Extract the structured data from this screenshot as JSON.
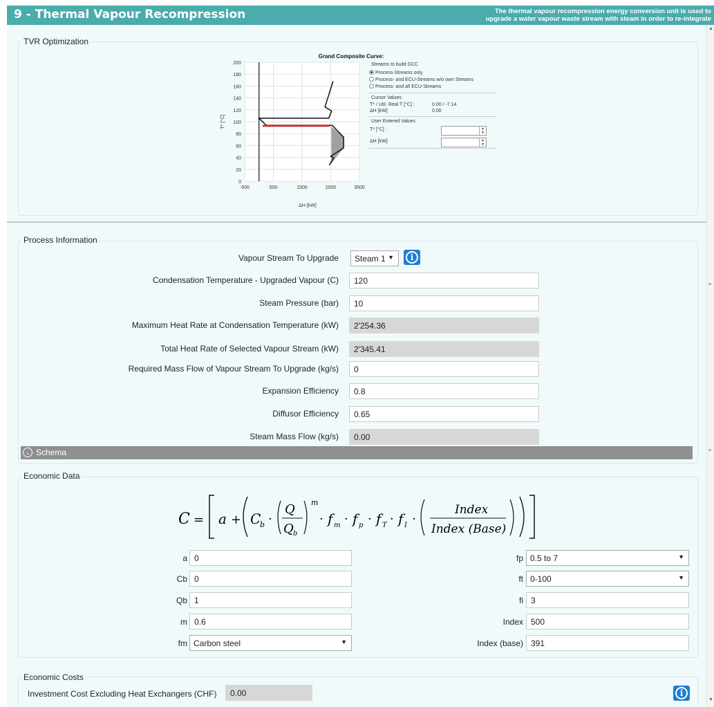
{
  "header": {
    "title": "9 - Thermal Vapour Recompression",
    "description_line1": "The thermal vapour recompression energy conversion unit is used to",
    "description_line2": "upgrade a water vapour waste stream with steam in order to re-integrate"
  },
  "colors": {
    "header_bg": "#4aacac",
    "panel_bg": "#f1fafb",
    "readonly_bg": "#d7d7d7",
    "info_button": "#1e7ed6",
    "curve_red": "#e0262b",
    "fill_grey": "#a0a0a0"
  },
  "tvr": {
    "legend": "TVR Optimization",
    "side": {
      "streams_title": "Streams to build GCC",
      "radio_options": [
        "Process-Streams only",
        "Process- and ECU-Streams w/o own Streams",
        "Process- and all ECU-Streams"
      ],
      "selected_radio": 0,
      "cursor_title": "Cursor Values",
      "cursor_t_label": "T* / Util. Real T [°C] :",
      "cursor_t_value": "0.00 / -7.14",
      "cursor_h_label": "ΔH [kW]",
      "cursor_h_value": "0.00",
      "user_title": "User Entered Values",
      "user_t_label": "T* [°C] :",
      "user_h_label": "ΔH [kW]",
      "spin_icons": [
        "spin-up-icon",
        "spin-down-icon"
      ]
    }
  },
  "chart_data": {
    "type": "line",
    "title": "Grand Composite Curve:",
    "xlabel": "ΔH [kW]",
    "ylabel": "T* [°C]",
    "xlim": [
      -500,
      3500
    ],
    "ylim": [
      0,
      200
    ],
    "x_ticks": [
      "-500",
      "500",
      "1500",
      "2500",
      "3500"
    ],
    "y_ticks": [
      "0",
      "20",
      "40",
      "60",
      "80",
      "100",
      "120",
      "140",
      "160",
      "180",
      "200"
    ],
    "grid": true,
    "series": [
      {
        "style": "black",
        "x": [
          2580,
          2300,
          2530,
          2430,
          0,
          250,
          2550,
          2950,
          2950,
          2500,
          2600,
          2450
        ],
        "y": [
          168,
          125,
          118,
          106,
          106,
          94,
          94,
          74,
          56,
          42,
          39,
          27
        ]
      },
      {
        "style": "red",
        "x": [
          120,
          2470
        ],
        "y": [
          93,
          93
        ]
      },
      {
        "style": "axis",
        "x": [
          0,
          0
        ],
        "y": [
          0,
          200
        ]
      },
      {
        "style": "fill",
        "x": [
          2520,
          2950,
          2950,
          2520
        ],
        "y": [
          92,
          74,
          56,
          30
        ]
      }
    ]
  },
  "process": {
    "legend": "Process Information",
    "fields": [
      {
        "label": "Vapour Stream To Upgrade",
        "value": "Steam 1",
        "kind": "select"
      },
      {
        "label": "Condensation Temperature - Upgraded Vapour (C)",
        "value": "120",
        "kind": "input"
      },
      {
        "label": "Steam Pressure (bar)",
        "value": "10",
        "kind": "input"
      },
      {
        "label": "Maximum Heat Rate at Condensation Temperature (kW)",
        "value": "2'254.36",
        "kind": "readonly"
      },
      {
        "label": "Total Heat Rate of Selected Vapour Stream (kW)",
        "value": "2'345.41",
        "kind": "readonly"
      },
      {
        "label": "Required Mass Flow of Vapour Stream To Upgrade (kg/s)",
        "value": "0",
        "kind": "input"
      },
      {
        "label": "Expansion Efficiency",
        "value": "0.8",
        "kind": "input"
      },
      {
        "label": "Diffusor Efficiency",
        "value": "0.65",
        "kind": "input"
      },
      {
        "label": "Steam Mass Flow (kg/s)",
        "value": "0.00",
        "kind": "readonly"
      }
    ]
  },
  "schema": {
    "label": "Schema"
  },
  "economic": {
    "legend": "Economic Data",
    "formula": {
      "C": "C",
      "eq": "=",
      "a": "a",
      "plus": "+",
      "Cb": "C",
      "b": "b",
      "Q": "Q",
      "Qb": "Q",
      "m": "m",
      "dot": "·",
      "fm": "f",
      "m_sub": "m",
      "fp": "f",
      "p_sub": "p",
      "fT": "f",
      "T_sub": "T",
      "fI": "f",
      "I_sub": "I",
      "index": "Index",
      "index_base": "Index  (Base)"
    },
    "left": [
      {
        "label": "a",
        "value": "0",
        "kind": "input"
      },
      {
        "label": "Cb",
        "value": "0",
        "kind": "input"
      },
      {
        "label": "Qb",
        "value": "1",
        "kind": "input"
      },
      {
        "label": "m",
        "value": "0.6",
        "kind": "input"
      },
      {
        "label": "fm",
        "value": "Carbon steel",
        "kind": "select"
      }
    ],
    "right": [
      {
        "label": "fp",
        "value": "0.5 to 7",
        "kind": "select"
      },
      {
        "label": "ft",
        "value": "0-100",
        "kind": "select"
      },
      {
        "label": "fi",
        "value": "3",
        "kind": "input"
      },
      {
        "label": "Index",
        "value": "500",
        "kind": "input"
      },
      {
        "label": "Index (base)",
        "value": "391",
        "kind": "input"
      }
    ]
  },
  "costs": {
    "legend": "Economic Costs",
    "label": "Investment Cost Excluding Heat Exchangers (CHF)",
    "value": "0.00"
  },
  "icons": {
    "info": "info-icon",
    "schema": "chevron-down-icon",
    "dropdown": "dropdown-arrow-icon"
  }
}
